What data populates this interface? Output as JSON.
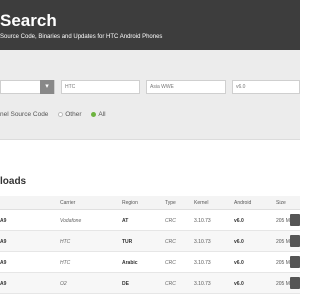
{
  "header": {
    "title": "Search",
    "subtitle": "Source Code, Binaries and Updates for HTC Android Phones"
  },
  "filters": {
    "select1": "",
    "select2": "HTC",
    "select3": "Asia WWE",
    "select4": "v6.0"
  },
  "radio": {
    "label": "nel Source Code",
    "other": "Other",
    "all": "All"
  },
  "section": {
    "title": "loads"
  },
  "table": {
    "headers": {
      "carrier": "Carrier",
      "region": "Region",
      "type": "Type",
      "kernel": "Kernel",
      "android": "Android",
      "size": "Size"
    },
    "rows": [
      {
        "name": "A9",
        "carrier": "Vodafone",
        "region": "AT",
        "type": "CRC",
        "kernel": "3.10.73",
        "android": "v6.0",
        "size": "205 MB"
      },
      {
        "name": "A9",
        "carrier": "HTC",
        "region": "TUR",
        "type": "CRC",
        "kernel": "3.10.73",
        "android": "v6.0",
        "size": "205 MB"
      },
      {
        "name": "A9",
        "carrier": "HTC",
        "region": "Arabic",
        "type": "CRC",
        "kernel": "3.10.73",
        "android": "v6.0",
        "size": "205 MB"
      },
      {
        "name": "A9",
        "carrier": "O2",
        "region": "DE",
        "type": "CRC",
        "kernel": "3.10.73",
        "android": "v6.0",
        "size": "205 MB"
      }
    ]
  }
}
